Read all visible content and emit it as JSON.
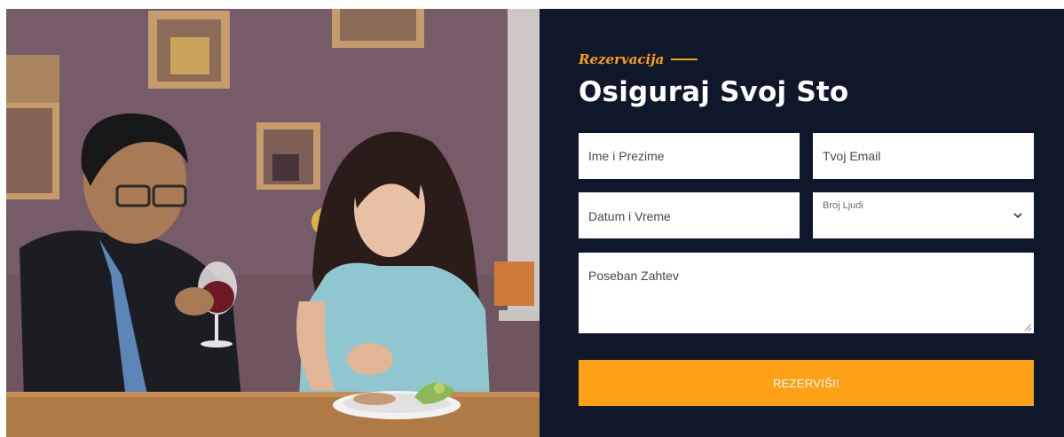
{
  "reservation": {
    "kicker": "Rezervacija",
    "title": "Osiguraj Svoj Sto",
    "fields": {
      "name_placeholder": "Ime i Prezime",
      "email_placeholder": "Tvoj Email",
      "datetime_placeholder": "Datum i Vreme",
      "people_label": "Broj Ljudi",
      "request_placeholder": "Poseban Zahtev"
    },
    "submit_label": "REZERVIŠI!"
  },
  "colors": {
    "accent": "#fea116",
    "panel_bg": "#0f172b"
  },
  "icons": {
    "select_arrow": "chevron-down-icon",
    "resize_handle": "resize-handle-icon"
  }
}
